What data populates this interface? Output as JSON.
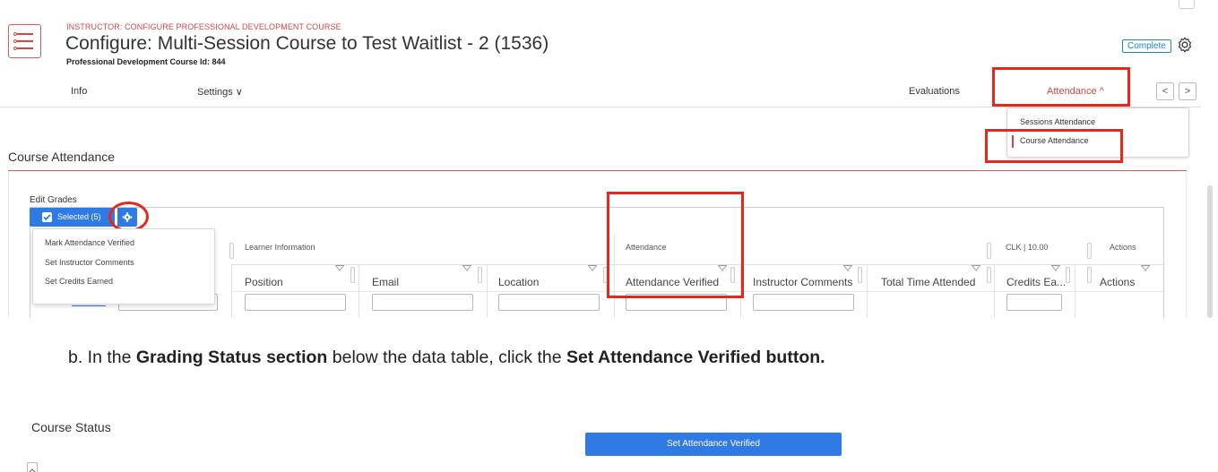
{
  "header": {
    "breadcrumb": "INSTRUCTOR: CONFIGURE PROFESSIONAL DEVELOPMENT COURSE",
    "title": "Configure: Multi-Session Course to Test Waitlist - 2 (1536)",
    "course_id": "Professional Development Course Id: 844",
    "status_badge": "Complete",
    "icons": {
      "course": "course-list-icon",
      "settings": "gear-icon"
    }
  },
  "tabs": [
    {
      "label": "Info"
    },
    {
      "label": "Settings ∨"
    },
    {
      "label": "Evaluations"
    },
    {
      "label": "Attendance ^"
    }
  ],
  "nav": {
    "prev": "<",
    "next": ">"
  },
  "attendance_menu": {
    "items": [
      {
        "label": "Sessions Attendance"
      },
      {
        "label": "Course Attendance"
      }
    ]
  },
  "section": {
    "title": "Course Attendance",
    "edit_grades": "Edit Grades"
  },
  "toolbar": {
    "selected_label": "Selected (5)"
  },
  "bulk_actions": [
    {
      "label": "Mark Attendance Verified"
    },
    {
      "label": "Set Instructor Comments"
    },
    {
      "label": "Set Credits Earned"
    }
  ],
  "grid": {
    "group_headers": [
      "Learner Information",
      "Attendance",
      "CLK | 10.00",
      "Actions"
    ],
    "columns": [
      "Position",
      "Email",
      "Location",
      "Attendance Verified",
      "Instructor Comments",
      "Total Time Attended",
      "Credits Ea...",
      "Actions"
    ]
  },
  "instruction": {
    "prefix": "b.  In the ",
    "section_name": "Grading Status section",
    "middle": " below the data table, click the ",
    "button_name": "Set Attendance Verified button."
  },
  "status": {
    "title": "Course Status",
    "button_label": "Set Attendance Verified"
  },
  "colors": {
    "accent_blue": "#2f7ae5",
    "brand_red": "#d64545",
    "highlight_red": "#e8271b"
  }
}
